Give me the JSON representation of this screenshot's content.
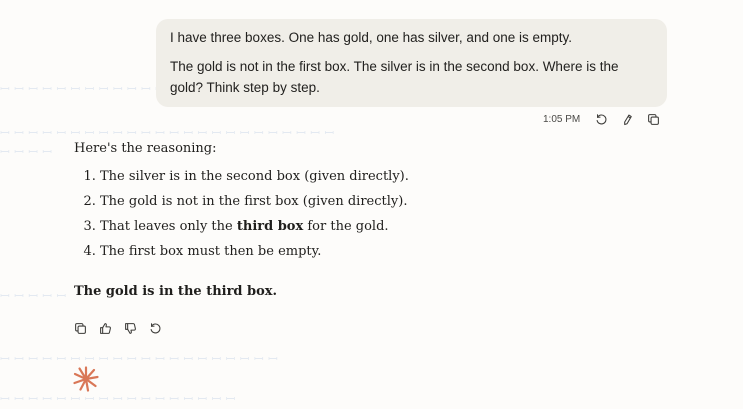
{
  "user_message": {
    "paragraph_1": "I have three boxes. One has gold, one has silver, and one is empty.",
    "paragraph_2": "The gold is not in the first box. The silver is in the second box. Where is the gold? Think step by step.",
    "timestamp": "1:05 PM",
    "actions": [
      "retry-icon",
      "edit-icon",
      "copy-icon"
    ]
  },
  "assistant_message": {
    "intro": "Here's the reasoning:",
    "steps": [
      {
        "pre": "The silver is in the second box (given directly).",
        "bold": "",
        "post": ""
      },
      {
        "pre": "The gold is not in the first box (given directly).",
        "bold": "",
        "post": ""
      },
      {
        "pre": "That leaves only the ",
        "bold": "third box",
        "post": " for the gold."
      },
      {
        "pre": "The first box must then be empty.",
        "bold": "",
        "post": ""
      }
    ],
    "conclusion": "The gold is in the third box.",
    "actions": [
      "copy-icon",
      "thumbs-up-icon",
      "thumbs-down-icon",
      "retry-icon"
    ]
  },
  "colors": {
    "page_bg": "#fdfcfa",
    "user_bubble_bg": "#f0eee8",
    "spark_accent": "#d97757"
  }
}
